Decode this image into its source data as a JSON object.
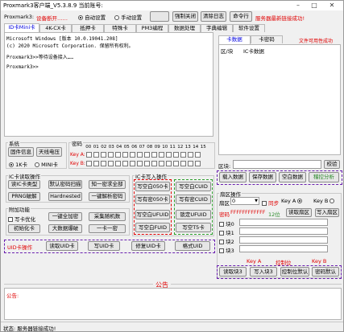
{
  "title": "Proxmark3客户端_V5.3.8.9 当前账号:",
  "top": {
    "label": "Proxmark3:",
    "status": "设备断开……",
    "auto": "自动设置",
    "manual": "手动设置",
    "force_close": "强制关闭",
    "clear_log": "清除日志",
    "cmd": "命令行",
    "server_msg": "服务器最新链接成功!"
  },
  "main_tabs": [
    "ID卡Mini卡",
    "4K-CX卡",
    "抵押卡",
    "特殊卡",
    "PM3编程",
    "数据处理",
    "字典编辑",
    "软件设置"
  ],
  "log": {
    "line1": "Microsoft Windows [版本 10.0.19041.208]",
    "line2": "(c) 2020 Microsoft Corporation. 保留所有权利。",
    "line3": "Proxmark3>>等待设备接入……",
    "line4": "Proxmark3>>"
  },
  "right_tabs": [
    "卡数据",
    "卡密码"
  ],
  "right_tab_red": "文件可用性成功",
  "data_cols": [
    "区/块",
    "IC卡数据"
  ],
  "block_label": "区块:",
  "check_btn": "校验",
  "data_btns": [
    "载入数据",
    "保存数据",
    "空白数据",
    "稽控分析"
  ],
  "system": {
    "title": "系统",
    "info": "固件信息",
    "antenna": "天线电压",
    "k1": "1K卡",
    "mini": "MINI卡"
  },
  "pwd": {
    "title": "密码",
    "cols": [
      "00",
      "01",
      "02",
      "03",
      "04",
      "05",
      "06",
      "07",
      "08",
      "09",
      "10",
      "11",
      "12",
      "13",
      "14",
      "15"
    ],
    "keyA": "Key A:",
    "keyB": "Key B:"
  },
  "ic_read": {
    "title": "IC卡读取操作",
    "btns": [
      "读IC卡类型",
      "默认密码扫描",
      "知一密求全部",
      "PRNG破解",
      "Hardnested",
      "一键解析密码"
    ]
  },
  "attach": {
    "title": "附加功能",
    "write_lock": "写卡优化",
    "btns": [
      "一键全加密",
      "采集随机数",
      "初始化卡",
      "大数据爆破",
      "一卡一密"
    ]
  },
  "ic_write": {
    "title": "IC卡写入操作",
    "btns": [
      "写空白050卡",
      "写空白CUID",
      "写有密050卡",
      "写有密CUID",
      "写空白UFUID",
      "锁定UFUID",
      "写空白FUID",
      "写空T5卡"
    ]
  },
  "uid_bar": {
    "label": "UID卡操作",
    "btns": [
      "读取UID卡",
      "写UID卡",
      "修复UID卡",
      "格式UID"
    ]
  },
  "sector": {
    "title": "扇区操作",
    "sector_lbl": "扇区",
    "sector_val": "0",
    "sync": "同步",
    "keyA": "Key A",
    "keyB": "Key B",
    "pwd_lbl": "密码",
    "pwd_val": "FFFFFFFFFFFF",
    "len": "12位",
    "read_sector": "读取扇区",
    "write_sector": "写入扇区",
    "blocks": [
      "块0",
      "块1",
      "块2",
      "块3"
    ],
    "keyA2": "Key A",
    "ctrl": "控制位",
    "keyB2": "Key B",
    "btns": [
      "读取块3",
      "写入块3",
      "控制位默认",
      "密码默认"
    ]
  },
  "notice": {
    "title": "公告",
    "label": "公告:"
  },
  "statusbar": "状态: 服务器链接成功!"
}
